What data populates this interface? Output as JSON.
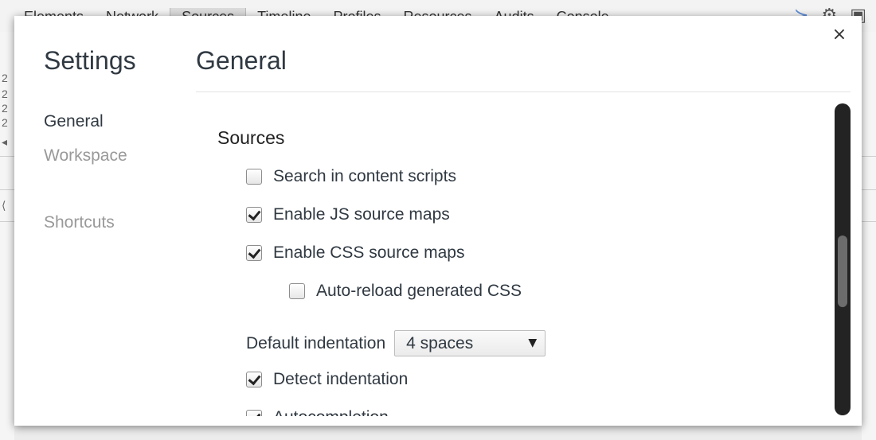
{
  "background_devtools": {
    "tabs": [
      "Elements",
      "Network",
      "Sources",
      "Timeline",
      "Profiles",
      "Resources",
      "Audits",
      "Console"
    ],
    "selected_tab_index": 2,
    "gutter_marks": [
      "2",
      "2",
      "2",
      "2",
      "◂",
      "⟨"
    ]
  },
  "dialog": {
    "close_label": "×",
    "title": "Settings",
    "nav": {
      "items": [
        {
          "label": "General",
          "active": true
        },
        {
          "label": "Workspace",
          "active": false
        },
        {
          "label": "Shortcuts",
          "active": false
        }
      ]
    },
    "section_title": "General",
    "sources": {
      "heading": "Sources",
      "options": [
        {
          "label": "Search in content scripts",
          "checked": false,
          "indent": 0
        },
        {
          "label": "Enable JS source maps",
          "checked": true,
          "indent": 0
        },
        {
          "label": "Enable CSS source maps",
          "checked": true,
          "indent": 0
        },
        {
          "label": "Auto-reload generated CSS",
          "checked": false,
          "indent": 1
        }
      ],
      "default_indentation": {
        "label": "Default indentation",
        "value": "4 spaces"
      },
      "options_after": [
        {
          "label": "Detect indentation",
          "checked": true
        },
        {
          "label": "Autocompletion",
          "checked": true
        }
      ]
    },
    "scrollbar": {
      "position_fraction": 0.55,
      "thumb_fraction": 0.23
    }
  }
}
